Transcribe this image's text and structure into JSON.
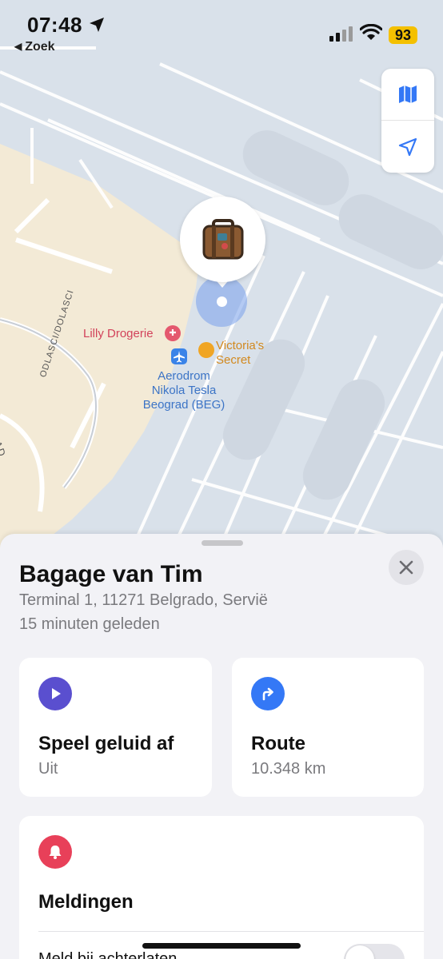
{
  "status_bar": {
    "time": "07:48",
    "back_label": "Zoek",
    "battery": "93"
  },
  "map": {
    "labels": {
      "lilly": "Lilly Drogerie",
      "victoria": "Victoria's\nSecret",
      "airport": "Aerodrom\nNikola Tesla\nBeograd (BEG)",
      "road1": "ODLASCI/DOLASCI",
      "road2": "DAD"
    },
    "pin_icon": "suitcase-icon",
    "colors": {
      "accent": "#3478f6",
      "accuracy": "#78a0eb"
    }
  },
  "sheet": {
    "title": "Bagage van Tim",
    "address": "Terminal 1, 11271 Belgrado, Servië",
    "updated": "15 minuten geleden",
    "sound_card": {
      "icon": "play-icon",
      "icon_color": "#5a4fcf",
      "title": "Speel geluid af",
      "subtitle": "Uit"
    },
    "route_card": {
      "icon": "directions-arrow-icon",
      "icon_color": "#3478f6",
      "title": "Route",
      "subtitle": "10.348 km"
    },
    "notify_card": {
      "icon": "bell-icon",
      "icon_color": "#e84059",
      "title": "Meldingen",
      "row_label": "Meld bij achterlaten"
    }
  }
}
